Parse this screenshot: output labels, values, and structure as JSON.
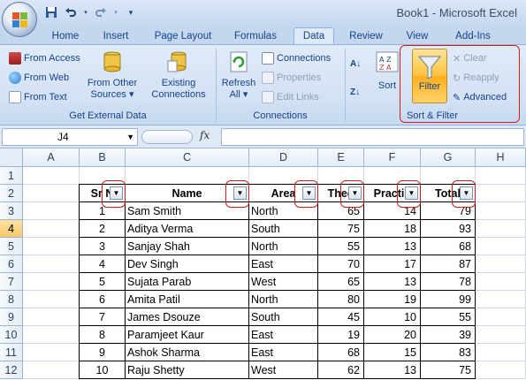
{
  "app": {
    "title": "Book1 - Microsoft Excel"
  },
  "qat": {
    "save": "save-icon",
    "undo": "undo-icon",
    "redo": "redo-icon",
    "customize": "customize-arrow-icon"
  },
  "tabs": [
    "Home",
    "Insert",
    "Page Layout",
    "Formulas",
    "Data",
    "Review",
    "View",
    "Add-Ins"
  ],
  "active_tab": "Data",
  "ribbon": {
    "get_external": {
      "label": "Get External Data",
      "from_access": "From Access",
      "from_web": "From Web",
      "from_text": "From Text",
      "from_other_1": "From Other",
      "from_other_2": "Sources ▾",
      "existing_1": "Existing",
      "existing_2": "Connections"
    },
    "connections": {
      "label": "Connections",
      "refresh_1": "Refresh",
      "refresh_2": "All ▾",
      "connections": "Connections",
      "properties": "Properties",
      "edit_links": "Edit Links"
    },
    "sort_filter": {
      "label": "Sort & Filter",
      "sort": "Sort",
      "filter": "Filter",
      "clear": "Clear",
      "reapply": "Reapply",
      "advanced": "Advanced"
    }
  },
  "formula_bar": {
    "name_box": "J4",
    "fx": "fx",
    "formula": ""
  },
  "columns": [
    "A",
    "B",
    "C",
    "D",
    "E",
    "F",
    "G",
    "H"
  ],
  "rows": [
    "1",
    "2",
    "3",
    "4",
    "5",
    "6",
    "7",
    "8",
    "9",
    "10",
    "11",
    "12"
  ],
  "table": {
    "headers": [
      "Sr N",
      "Name",
      "Area",
      "Theo",
      "Practic",
      "Total"
    ],
    "rows": [
      [
        "1",
        "Sam Smith",
        "North",
        "65",
        "14",
        "79"
      ],
      [
        "2",
        "Aditya Verma",
        "South",
        "75",
        "18",
        "93"
      ],
      [
        "3",
        "Sanjay Shah",
        "North",
        "55",
        "13",
        "68"
      ],
      [
        "4",
        "Dev Singh",
        "East",
        "70",
        "17",
        "87"
      ],
      [
        "5",
        "Sujata Parab",
        "West",
        "65",
        "13",
        "78"
      ],
      [
        "6",
        "Amita Patil",
        "North",
        "80",
        "19",
        "99"
      ],
      [
        "7",
        "James Dsouze",
        "South",
        "45",
        "10",
        "55"
      ],
      [
        "8",
        "Paramjeet Kaur",
        "East",
        "19",
        "20",
        "39"
      ],
      [
        "9",
        "Ashok Sharma",
        "East",
        "68",
        "15",
        "83"
      ],
      [
        "10",
        "Raju Shetty",
        "West",
        "62",
        "13",
        "75"
      ]
    ]
  },
  "colors": {
    "highlight": "#d21b1b",
    "accent": "#15428b",
    "filter_active": "#ffc23c"
  }
}
